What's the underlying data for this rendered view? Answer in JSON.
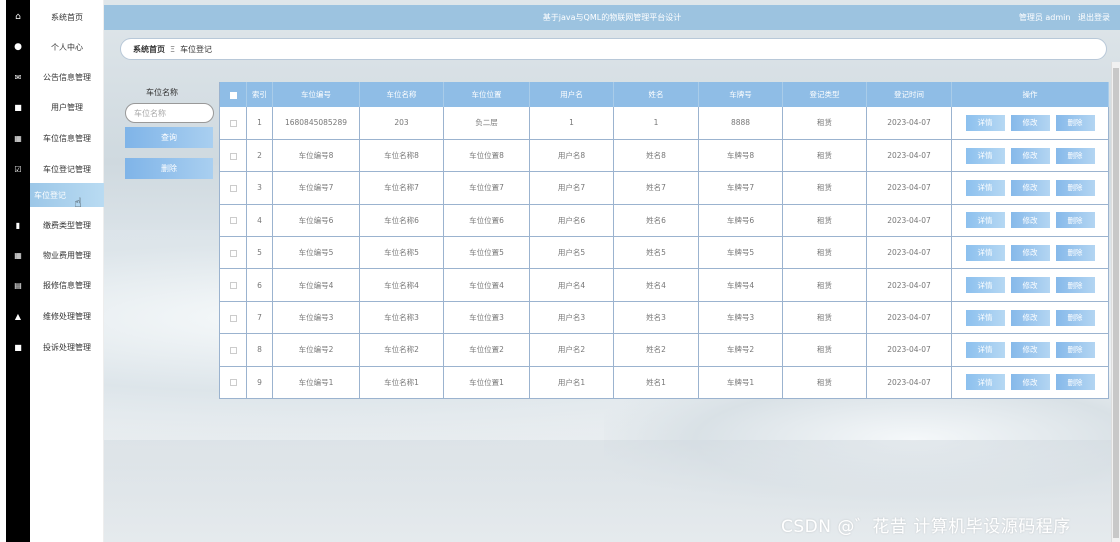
{
  "header": {
    "title": "基于java与QML的物联网管理平台设计",
    "user_label": "管理员 admin",
    "logout": "退出登录"
  },
  "sidebar": {
    "items": [
      {
        "label": "系统首页",
        "icon": "home-icon"
      },
      {
        "label": "个人中心",
        "icon": "user-icon"
      },
      {
        "label": "公告信息管理",
        "icon": "notice-icon"
      },
      {
        "label": "用户管理",
        "icon": "monitor-icon"
      },
      {
        "label": "车位信息管理",
        "icon": "grid-icon"
      },
      {
        "label": "车位登记管理",
        "icon": "check-icon"
      },
      {
        "label": "车位登记",
        "icon": "",
        "active": true
      },
      {
        "label": "缴费类型管理",
        "icon": "clipboard-icon"
      },
      {
        "label": "物业费用管理",
        "icon": "grid-icon"
      },
      {
        "label": "报修信息管理",
        "icon": "table-icon"
      },
      {
        "label": "维修处理管理",
        "icon": "upload-icon"
      },
      {
        "label": "投诉处理管理",
        "icon": "monitor-icon"
      }
    ]
  },
  "breadcrumb": {
    "home": "系统首页",
    "separator": "Ξ",
    "current": "车位登记"
  },
  "search": {
    "label": "车位名称",
    "placeholder": "车位名称",
    "query_button": "查询",
    "delete_button": "删除"
  },
  "table": {
    "columns": [
      "索引",
      "车位编号",
      "车位名称",
      "车位位置",
      "用户名",
      "姓名",
      "车牌号",
      "登记类型",
      "登记时间",
      "操作"
    ],
    "rows": [
      [
        "1",
        "1680845085289",
        "203",
        "负二层",
        "1",
        "1",
        "8888",
        "租赁",
        "2023-04-07"
      ],
      [
        "2",
        "车位编号8",
        "车位名称8",
        "车位位置8",
        "用户名8",
        "姓名8",
        "车牌号8",
        "租赁",
        "2023-04-07"
      ],
      [
        "3",
        "车位编号7",
        "车位名称7",
        "车位位置7",
        "用户名7",
        "姓名7",
        "车牌号7",
        "租赁",
        "2023-04-07"
      ],
      [
        "4",
        "车位编号6",
        "车位名称6",
        "车位位置6",
        "用户名6",
        "姓名6",
        "车牌号6",
        "租赁",
        "2023-04-07"
      ],
      [
        "5",
        "车位编号5",
        "车位名称5",
        "车位位置5",
        "用户名5",
        "姓名5",
        "车牌号5",
        "租赁",
        "2023-04-07"
      ],
      [
        "6",
        "车位编号4",
        "车位名称4",
        "车位位置4",
        "用户名4",
        "姓名4",
        "车牌号4",
        "租赁",
        "2023-04-07"
      ],
      [
        "7",
        "车位编号3",
        "车位名称3",
        "车位位置3",
        "用户名3",
        "姓名3",
        "车牌号3",
        "租赁",
        "2023-04-07"
      ],
      [
        "8",
        "车位编号2",
        "车位名称2",
        "车位位置2",
        "用户名2",
        "姓名2",
        "车牌号2",
        "租赁",
        "2023-04-07"
      ],
      [
        "9",
        "车位编号1",
        "车位名称1",
        "车位位置1",
        "用户名1",
        "姓名1",
        "车牌号1",
        "租赁",
        "2023-04-07"
      ]
    ],
    "actions": {
      "detail": "详情",
      "edit": "修改",
      "delete": "删除"
    }
  },
  "watermark": "CSDN @゛花昔  计算机毕设源码程序",
  "colors": {
    "header": "#9cc3e0",
    "accent": "#8fbde6",
    "sidebar_strip": "#000000"
  }
}
